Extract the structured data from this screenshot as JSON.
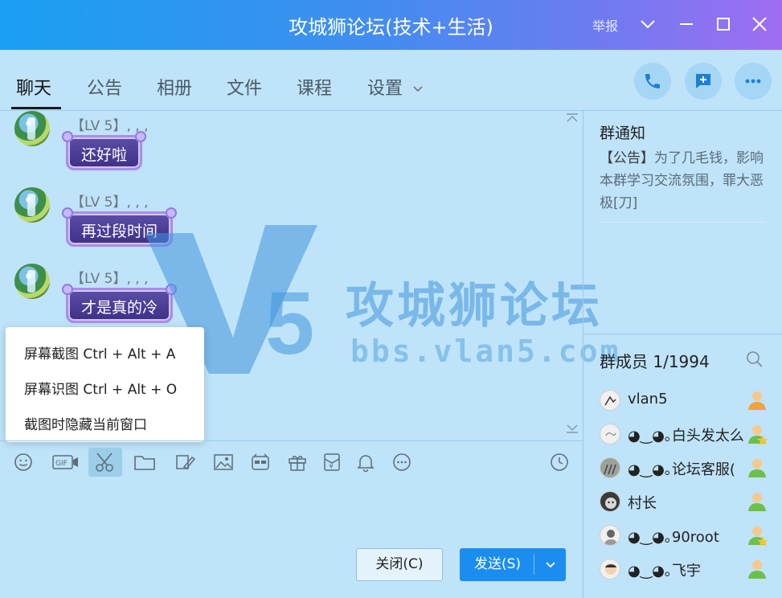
{
  "window": {
    "title": "攻城狮论坛(技术+生活)",
    "report_label": "举报"
  },
  "tabs": [
    {
      "label": "聊天",
      "active": true
    },
    {
      "label": "公告"
    },
    {
      "label": "相册"
    },
    {
      "label": "文件"
    },
    {
      "label": "课程"
    },
    {
      "label": "设置"
    }
  ],
  "header_actions": [
    "phone-icon",
    "add-message-icon",
    "more-icon"
  ],
  "messages": [
    {
      "meta": "【LV 5】, , ,",
      "text": "还好啦"
    },
    {
      "meta": "【LV 5】, , ,",
      "text": "再过段时间"
    },
    {
      "meta": "【LV 5】, , ,",
      "text": "才是真的冷"
    }
  ],
  "watermark": {
    "name": "攻城狮论坛",
    "url": "bbs.vlan5.com",
    "logo": "V5"
  },
  "context_menu": {
    "items": [
      "屏幕截图 Ctrl + Alt + A",
      "屏幕识图 Ctrl + Alt + O",
      "截图时隐藏当前窗口"
    ]
  },
  "toolbar": {
    "tools": [
      "emoji-icon",
      "gif-icon",
      "scissors-icon",
      "folder-icon",
      "image-edit-icon",
      "picture-icon",
      "sticker-icon",
      "gift-icon",
      "red-packet-icon",
      "bell-icon",
      "more-circle-icon",
      "history-icon"
    ],
    "close_label": "关闭(C)",
    "send_label": "发送(S)"
  },
  "notice": {
    "title": "群通知",
    "prefix": "【公告】",
    "text": "为了几毛钱，影响本群学习交流氛围，罪大恶极[刀]"
  },
  "members": {
    "title": "群成员 1/1994",
    "list": [
      {
        "name": "vlan5",
        "role": "owner-icon"
      },
      {
        "name": "◕‿◕｡白头发太么",
        "role": "admin-icon"
      },
      {
        "name": "◕‿◕｡论坛客服(",
        "role": "member-icon"
      },
      {
        "name": "村长",
        "role": "member-icon"
      },
      {
        "name": "◕‿◕｡90root",
        "role": "admin-icon"
      },
      {
        "name": "◕‿◕｡飞宇",
        "role": "member-icon"
      }
    ]
  },
  "colors": {
    "titlebar_start": "#1aa0f3",
    "titlebar_end": "#a06df2",
    "background": "#bfe3f9",
    "send_button": "#1c8df0",
    "bubble": "#4a3c94"
  }
}
